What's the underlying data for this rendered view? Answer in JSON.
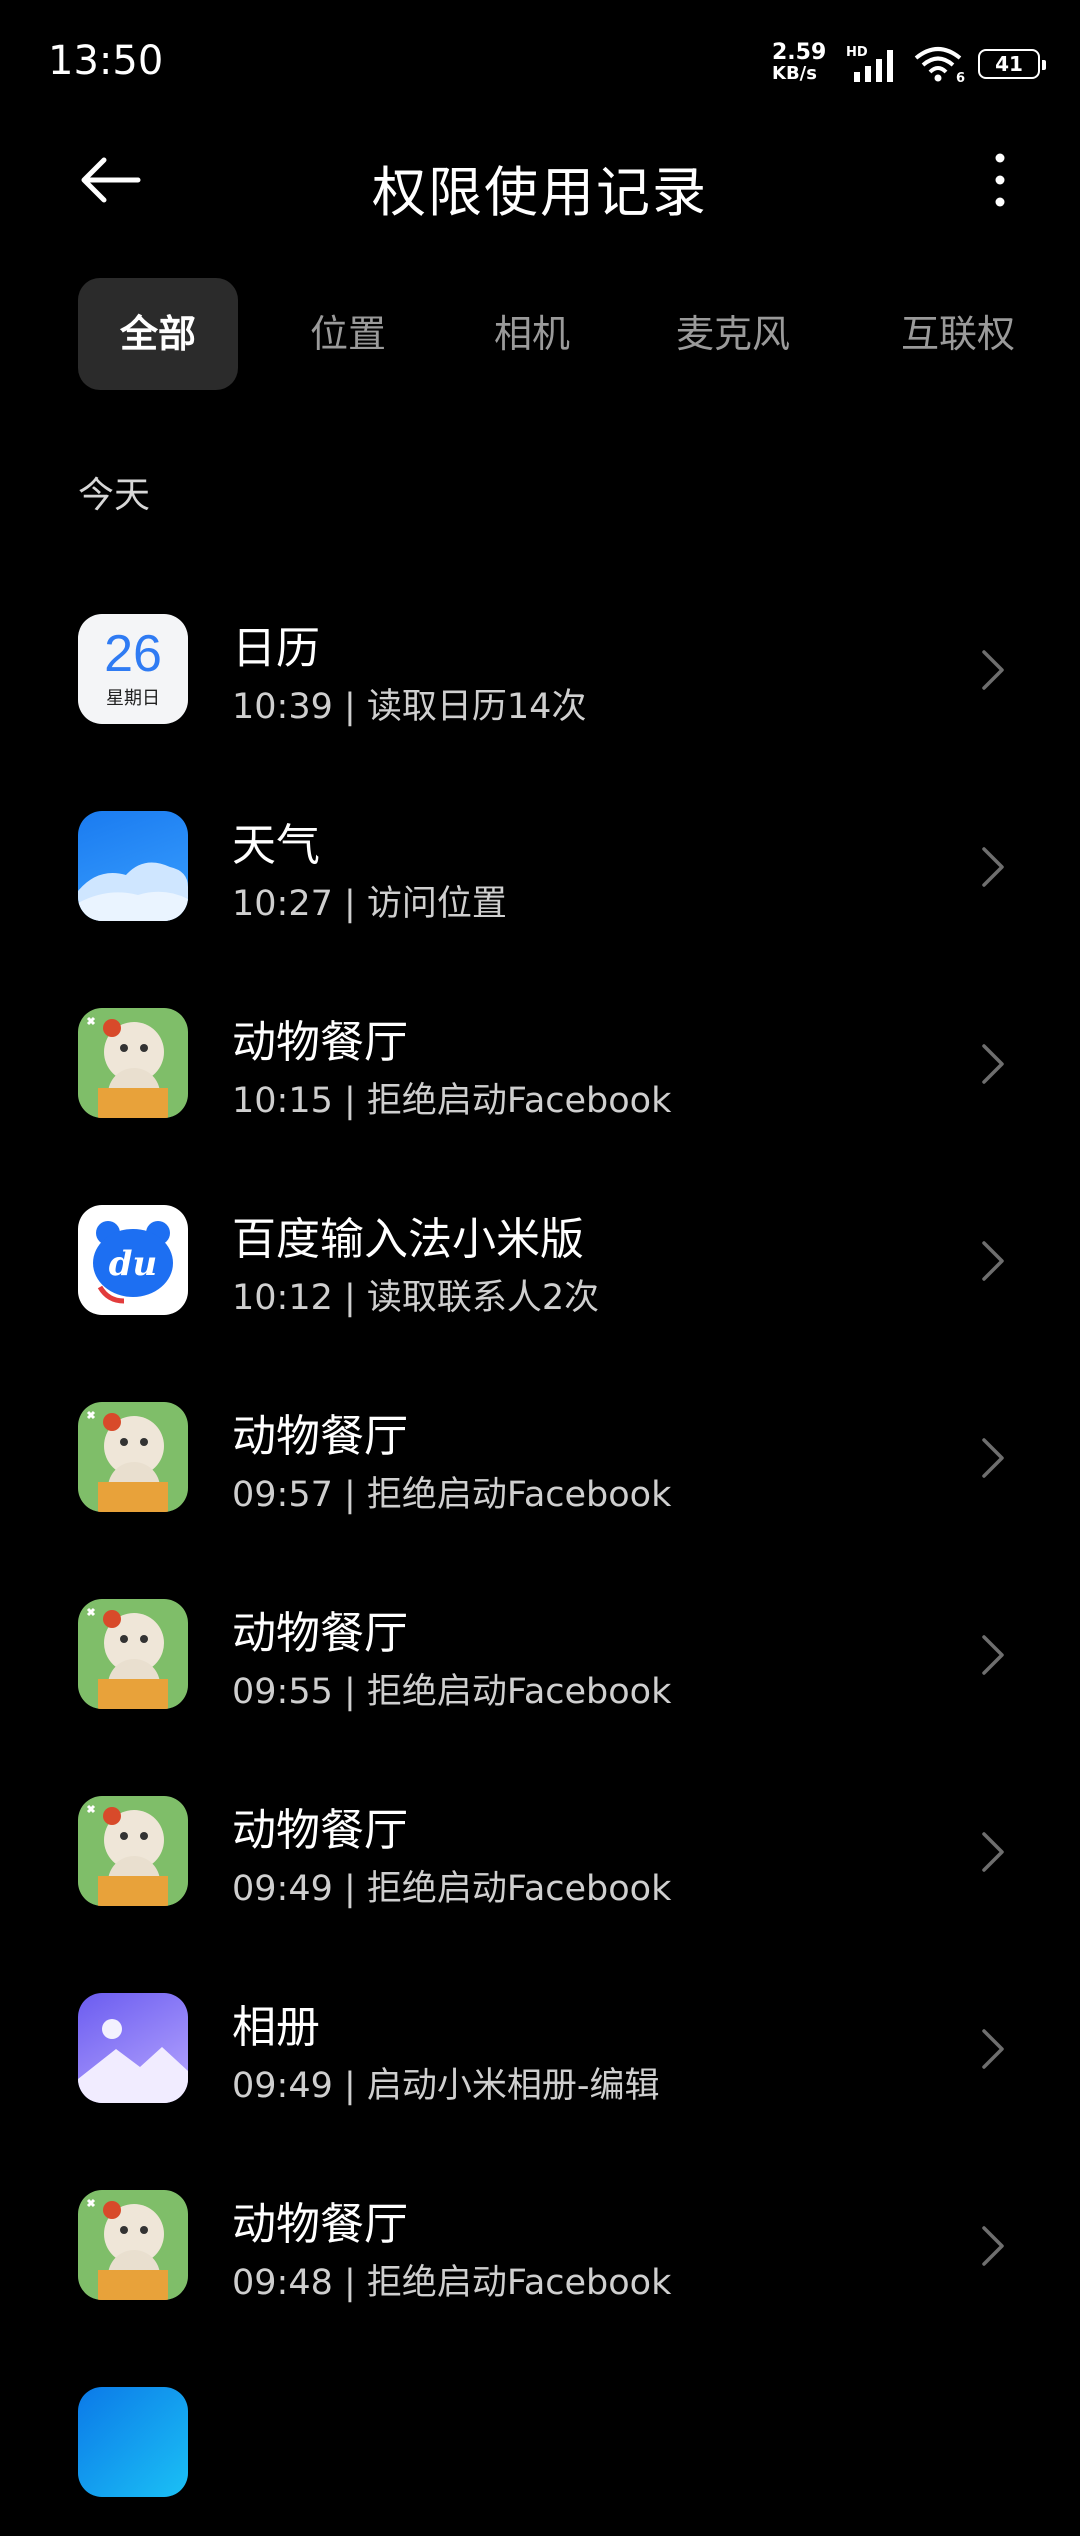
{
  "status_bar": {
    "time": "13:50",
    "net_speed_value": "2.59",
    "net_speed_unit": "KB/s",
    "hd": "HD",
    "wifi_label": "6",
    "battery": "41"
  },
  "header": {
    "title": "权限使用记录"
  },
  "tabs": [
    {
      "label": "全部",
      "active": true
    },
    {
      "label": "位置",
      "active": false
    },
    {
      "label": "相机",
      "active": false
    },
    {
      "label": "麦克风",
      "active": false
    },
    {
      "label": "互联权",
      "active": false
    }
  ],
  "section": {
    "label": "今天"
  },
  "calendar_icon": {
    "day": "26",
    "weekday": "星期日"
  },
  "baidu_icon": {
    "text": "du"
  },
  "records": [
    {
      "app": "日历",
      "detail": "10:39 | 读取日历14次",
      "icon": "calendar"
    },
    {
      "app": "天气",
      "detail": "10:27 | 访问位置",
      "icon": "weather"
    },
    {
      "app": "动物餐厅",
      "detail": "10:15 | 拒绝启动Facebook",
      "icon": "cafe"
    },
    {
      "app": "百度输入法小米版",
      "detail": "10:12 | 读取联系人2次",
      "icon": "baidu"
    },
    {
      "app": "动物餐厅",
      "detail": "09:57 | 拒绝启动Facebook",
      "icon": "cafe"
    },
    {
      "app": "动物餐厅",
      "detail": "09:55 | 拒绝启动Facebook",
      "icon": "cafe"
    },
    {
      "app": "动物餐厅",
      "detail": "09:49 | 拒绝启动Facebook",
      "icon": "cafe"
    },
    {
      "app": "相册",
      "detail": "09:49 | 启动小米相册-编辑",
      "icon": "album"
    },
    {
      "app": "动物餐厅",
      "detail": "09:48 | 拒绝启动Facebook",
      "icon": "cafe"
    }
  ],
  "colors": {
    "background": "#000000",
    "active_tab_bg": "#2b2b2b",
    "secondary_text": "#cfcfcf",
    "calendar_accent": "#2f7bf3",
    "baidu_blue": "#1d6ff2"
  }
}
